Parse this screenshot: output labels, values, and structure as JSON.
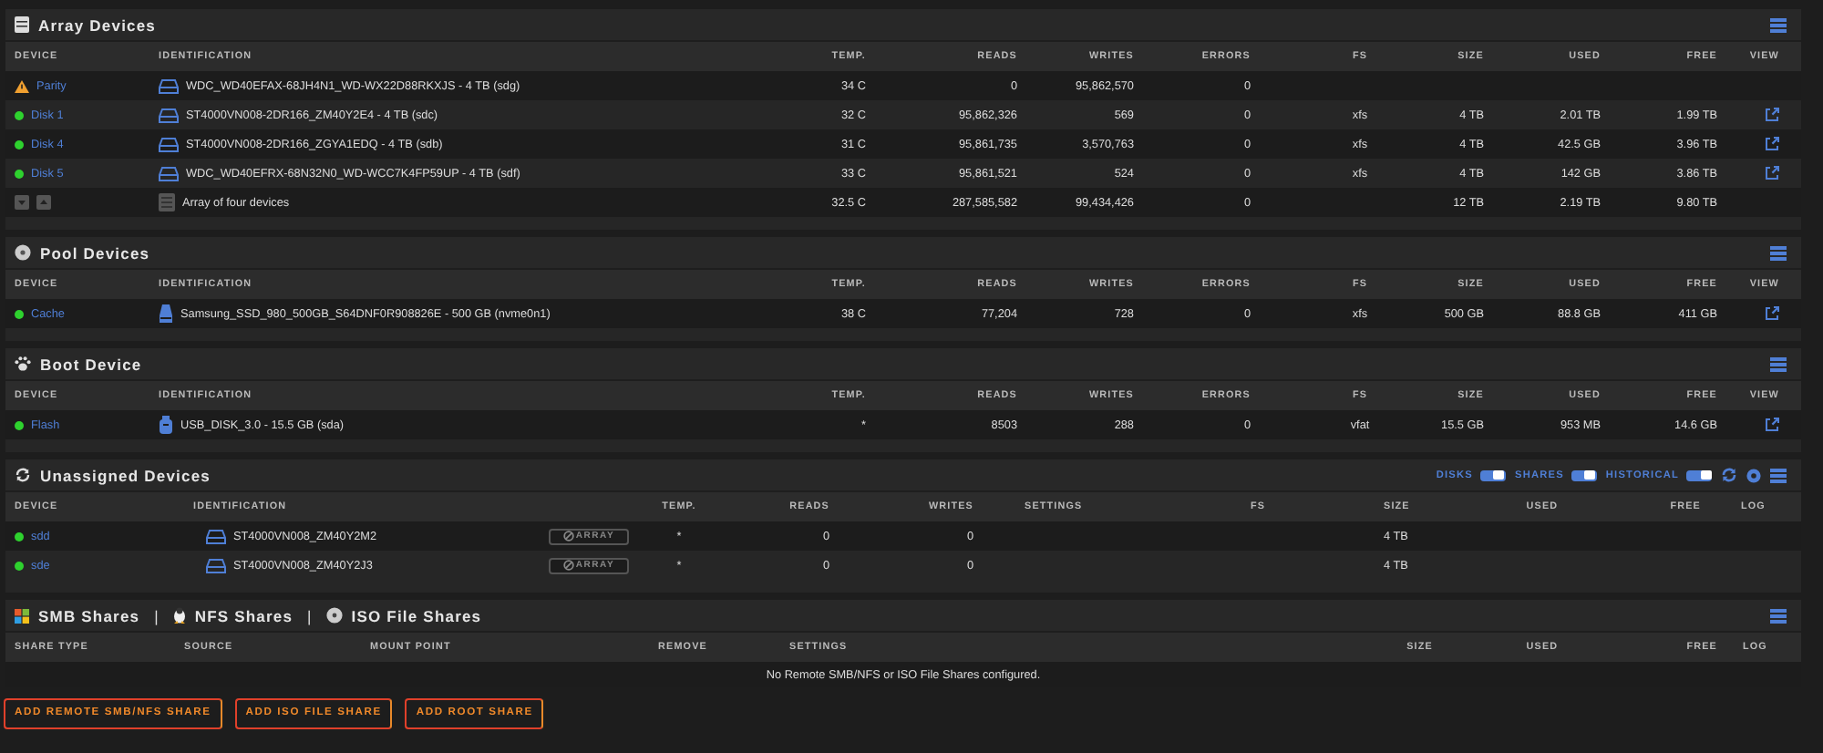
{
  "sections": [
    {
      "kind": "array",
      "title": "Array Devices",
      "columns": [
        "DEVICE",
        "IDENTIFICATION",
        "TEMP.",
        "READS",
        "WRITES",
        "ERRORS",
        "FS",
        "SIZE",
        "USED",
        "FREE",
        "VIEW"
      ],
      "rows": [
        {
          "kind": "disk",
          "warning": true,
          "device": "Parity",
          "identification": "WDC_WD40EFAX-68JH4N1_WD-WX22D88RKXJS - 4 TB (sdg)",
          "temp": "34 C",
          "reads": "0",
          "writes": "95,862,570",
          "errors": "0",
          "view": false
        },
        {
          "kind": "disk",
          "warning": false,
          "device": "Disk 1",
          "identification": "ST4000VN008-2DR166_ZM40Y2E4 - 4 TB (sdc)",
          "temp": "32 C",
          "reads": "95,862,326",
          "writes": "569",
          "errors": "0",
          "fs": "xfs",
          "size": "4 TB",
          "used": "2.01 TB",
          "free": "1.99 TB",
          "view": true
        },
        {
          "kind": "disk",
          "warning": false,
          "device": "Disk 4",
          "identification": "ST4000VN008-2DR166_ZGYA1EDQ - 4 TB (sdb)",
          "temp": "31 C",
          "reads": "95,861,735",
          "writes": "3,570,763",
          "errors": "0",
          "fs": "xfs",
          "size": "4 TB",
          "used": "42.5 GB",
          "free": "3.96 TB",
          "view": true
        },
        {
          "kind": "disk",
          "warning": false,
          "device": "Disk 5",
          "identification": "WDC_WD40EFRX-68N32N0_WD-WCC7K4FP59UP - 4 TB (sdf)",
          "temp": "33 C",
          "reads": "95,861,521",
          "writes": "524",
          "errors": "0",
          "fs": "xfs",
          "size": "4 TB",
          "used": "142 GB",
          "free": "3.86 TB",
          "view": true
        },
        {
          "kind": "summary",
          "identification": "Array of four devices",
          "temp": "32.5 C",
          "reads": "287,585,582",
          "writes": "99,434,426",
          "errors": "0",
          "size": "12 TB",
          "used": "2.19 TB",
          "free": "9.80 TB",
          "view": false
        }
      ]
    },
    {
      "kind": "pool",
      "title": "Pool Devices",
      "columns": [
        "DEVICE",
        "IDENTIFICATION",
        "TEMP.",
        "READS",
        "WRITES",
        "ERRORS",
        "FS",
        "SIZE",
        "USED",
        "FREE",
        "VIEW"
      ],
      "rows": [
        {
          "kind": "ssd",
          "warning": false,
          "device": "Cache",
          "identification": "Samsung_SSD_980_500GB_S64DNF0R908826E - 500 GB (nvme0n1)",
          "temp": "38 C",
          "reads": "77,204",
          "writes": "728",
          "errors": "0",
          "fs": "xfs",
          "size": "500 GB",
          "used": "88.8 GB",
          "free": "411 GB",
          "view": true
        }
      ]
    },
    {
      "kind": "boot",
      "title": "Boot Device",
      "columns": [
        "DEVICE",
        "IDENTIFICATION",
        "TEMP.",
        "READS",
        "WRITES",
        "ERRORS",
        "FS",
        "SIZE",
        "USED",
        "FREE",
        "VIEW"
      ],
      "rows": [
        {
          "kind": "usb",
          "warning": false,
          "device": "Flash",
          "identification": "USB_DISK_3.0 - 15.5 GB (sda)",
          "temp": "*",
          "reads": "8503",
          "writes": "288",
          "errors": "0",
          "fs": "vfat",
          "size": "15.5 GB",
          "used": "953 MB",
          "free": "14.6 GB",
          "view": true
        }
      ]
    },
    {
      "kind": "unassigned",
      "title": "Unassigned Devices",
      "toggles": [
        {
          "label": "DISKS",
          "on": true
        },
        {
          "label": "SHARES",
          "on": true
        },
        {
          "label": "HISTORICAL",
          "on": true
        }
      ],
      "columns": [
        "DEVICE",
        "IDENTIFICATION",
        "TEMP.",
        "READS",
        "WRITES",
        "SETTINGS",
        "FS",
        "SIZE",
        "USED",
        "FREE",
        "LOG"
      ],
      "rows": [
        {
          "kind": "disk",
          "warning": false,
          "device": "sdd",
          "identification": "ST4000VN008_ZM40Y2M2",
          "array_button": {
            "label": "ARRAY",
            "disabled": true
          },
          "temp": "*",
          "reads": "0",
          "writes": "0",
          "size": "4 TB"
        },
        {
          "kind": "disk",
          "warning": false,
          "device": "sde",
          "identification": "ST4000VN008_ZM40Y2J3",
          "array_button": {
            "label": "ARRAY",
            "disabled": true
          },
          "temp": "*",
          "reads": "0",
          "writes": "0",
          "size": "4 TB"
        }
      ]
    },
    {
      "kind": "shares",
      "title_parts": [
        {
          "kind": "tab",
          "label": "SMB Shares"
        },
        {
          "kind": "separator",
          "label": "|"
        },
        {
          "kind": "tab",
          "label": "NFS Shares"
        },
        {
          "kind": "separator",
          "label": "|"
        },
        {
          "kind": "tab",
          "label": "ISO File Shares"
        }
      ],
      "columns": [
        "SHARE TYPE",
        "SOURCE",
        "MOUNT POINT",
        "REMOVE",
        "SETTINGS",
        "SIZE",
        "USED",
        "FREE",
        "LOG"
      ],
      "empty_message": "No Remote SMB/NFS or ISO File Shares configured."
    }
  ],
  "buttons": [
    "ADD REMOTE SMB/NFS SHARE",
    "ADD ISO FILE SHARE",
    "ADD ROOT SHARE"
  ]
}
